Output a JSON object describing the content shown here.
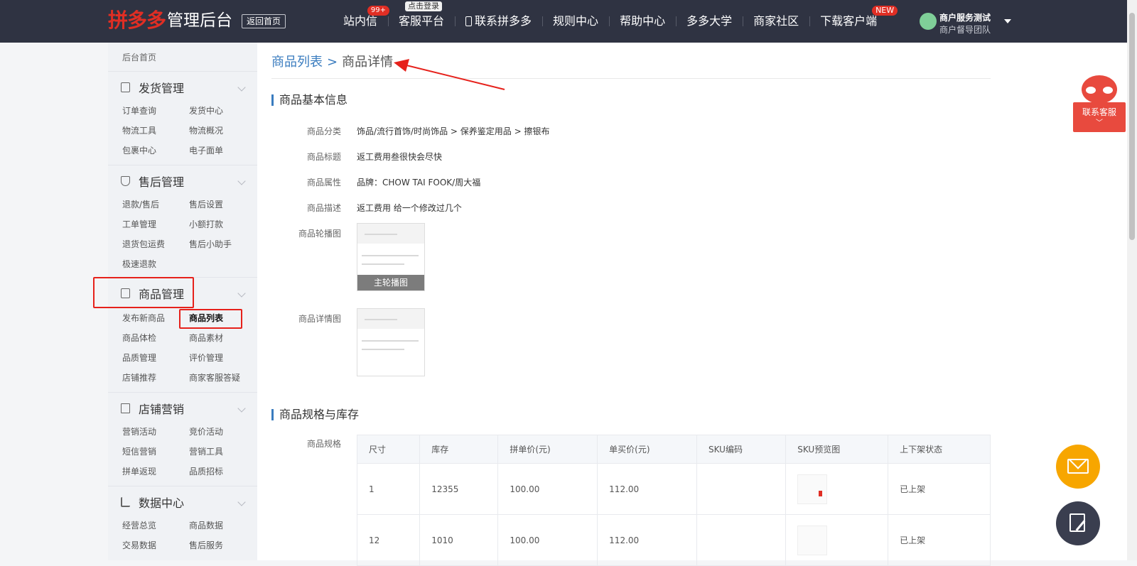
{
  "header": {
    "logo_brand": "拼多多",
    "logo_suffix": "管理后台",
    "home_button": "返回首页",
    "nav": [
      {
        "label": "站内信",
        "badge": "99+"
      },
      {
        "label": "客服平台",
        "tip": "点击登录"
      },
      {
        "label": "联系拼多多",
        "icon": "phone-icon"
      },
      {
        "label": "规则中心"
      },
      {
        "label": "帮助中心"
      },
      {
        "label": "多多大学"
      },
      {
        "label": "商家社区"
      },
      {
        "label": "下载客户端",
        "badge": "NEW"
      }
    ],
    "user": {
      "name": "商户服务测试",
      "team": "商户督导团队"
    }
  },
  "sidebar": {
    "home": "后台首页",
    "sections": [
      {
        "title": "发货管理",
        "icon": "list-icon",
        "items": [
          "订单查询",
          "发货中心",
          "物流工具",
          "物流概况",
          "包裹中心",
          "电子面单"
        ]
      },
      {
        "title": "售后管理",
        "icon": "shield-icon",
        "items": [
          "退款/售后",
          "售后设置",
          "工单管理",
          "小额打款",
          "退货包运费",
          "售后小助手",
          "极速退款"
        ]
      },
      {
        "title": "商品管理",
        "icon": "bag-icon",
        "items": [
          "发布新商品",
          "商品列表",
          "商品体检",
          "商品素材",
          "品质管理",
          "评价管理",
          "店铺推荐",
          "商家客服答疑"
        ]
      },
      {
        "title": "店铺营销",
        "icon": "gift-icon",
        "items": [
          "营销活动",
          "竞价活动",
          "短信营销",
          "营销工具",
          "拼单返现",
          "品质招标"
        ]
      },
      {
        "title": "数据中心",
        "icon": "bar-chart-icon",
        "items": [
          "经营总览",
          "商品数据",
          "交易数据",
          "售后服务"
        ]
      }
    ],
    "active_item": "商品列表"
  },
  "breadcrumb": {
    "parent": "商品列表",
    "separator": ">",
    "current": "商品详情"
  },
  "basic_info": {
    "title": "商品基本信息",
    "fields": [
      {
        "label": "商品分类",
        "value": "饰品/流行首饰/时尚饰品 > 保养鉴定用品 > 擦银布"
      },
      {
        "label": "商品标题",
        "value": "返工费用叁很快会尽快"
      },
      {
        "label": "商品属性",
        "value": "品牌：CHOW TAI FOOK/周大福"
      },
      {
        "label": "商品描述",
        "value": "返工费用 给一个修改过几个"
      }
    ],
    "carousel_label": "商品轮播图",
    "carousel_caption": "主轮播图",
    "detail_label": "商品详情图"
  },
  "spec": {
    "title": "商品规格与库存",
    "label": "商品规格",
    "columns": [
      "尺寸",
      "库存",
      "拼单价(元)",
      "单买价(元)",
      "SKU编码",
      "SKU预览图",
      "上下架状态"
    ],
    "rows": [
      [
        "1",
        "12355",
        "100.00",
        "112.00",
        "",
        "",
        "已上架"
      ],
      [
        "12",
        "1010",
        "100.00",
        "112.00",
        "",
        "",
        "已上架"
      ]
    ]
  },
  "float": {
    "cs_label": "联系客服"
  },
  "colors": {
    "brand": "#e02e24",
    "topbar": "#2f3342",
    "accent": "#3a7cbf",
    "mail": "#f7a600"
  }
}
